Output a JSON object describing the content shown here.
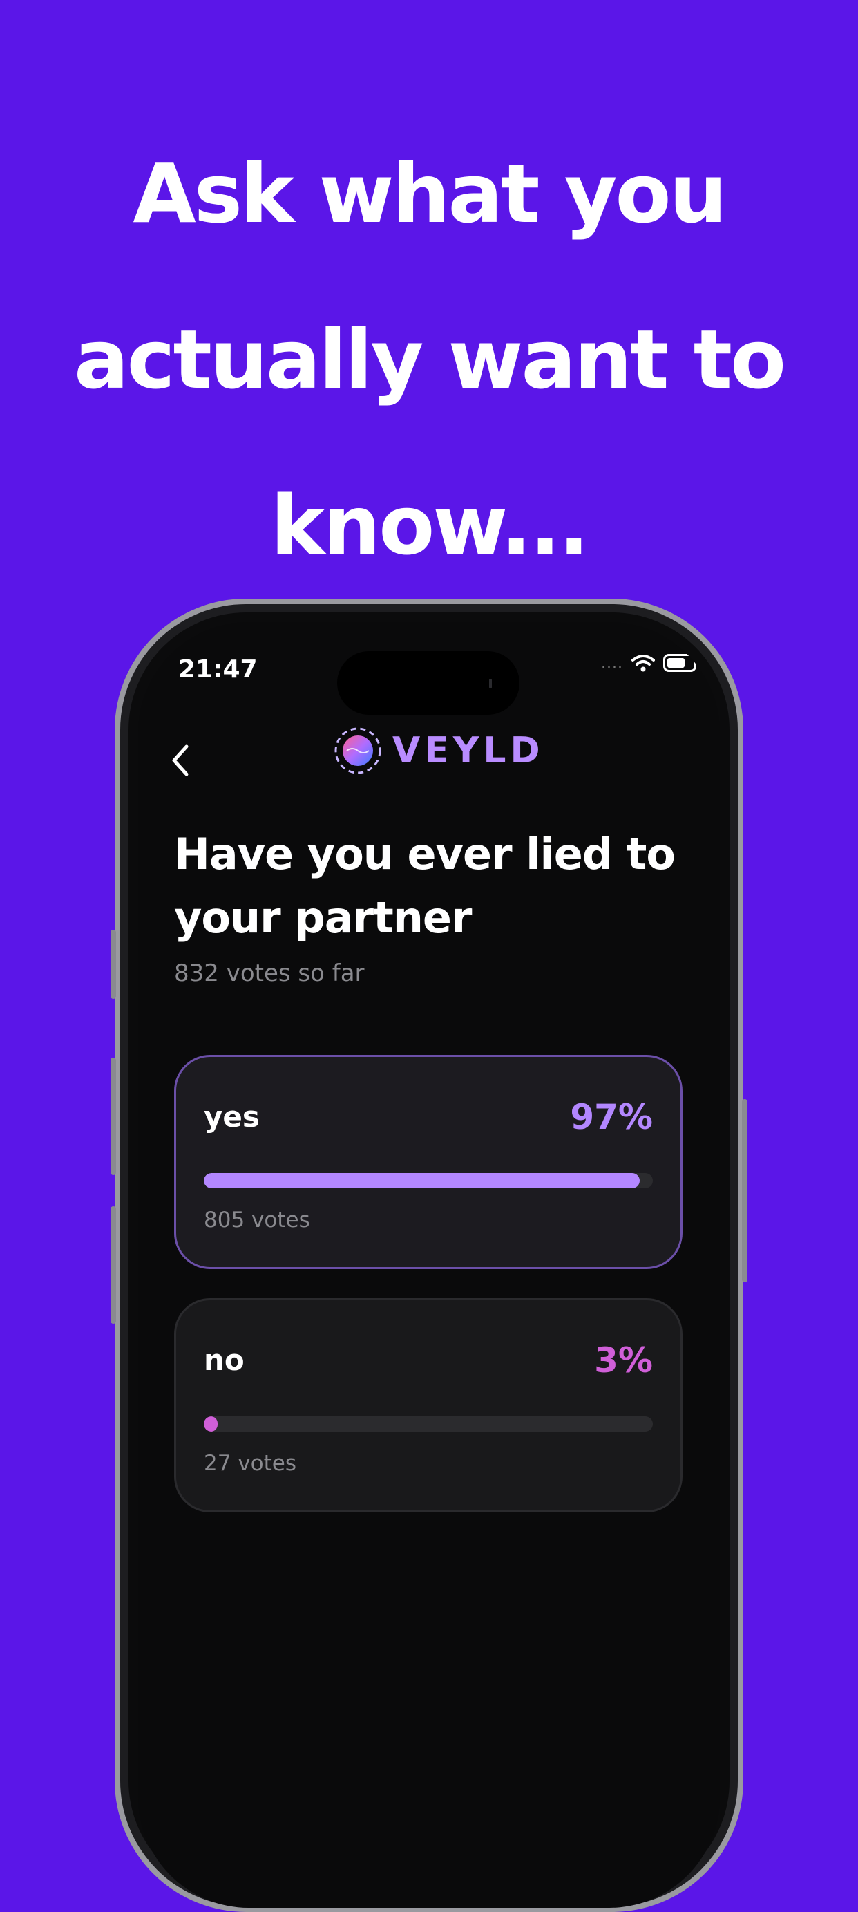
{
  "headline": {
    "lines": [
      "Ask what you",
      "actually want to",
      "know..."
    ]
  },
  "status_bar": {
    "time": "21:47",
    "signal": "....",
    "icons": [
      "wifi-icon",
      "battery-icon"
    ]
  },
  "header": {
    "back_icon": "chevron-left-icon",
    "logo_text": "VEYLD"
  },
  "poll": {
    "question": "Have you ever lied to your partner",
    "total_votes": "832 votes so far",
    "options": [
      {
        "label": "yes",
        "percent": "97%",
        "fraction": 0.97,
        "votes": "805 votes",
        "color": "#b387ff"
      },
      {
        "label": "no",
        "percent": "3%",
        "fraction": 0.03,
        "votes": "27 votes",
        "color": "#d05fd8"
      }
    ]
  },
  "colors": {
    "background": "#5b16e8",
    "logo_accent": "#b98cff"
  }
}
